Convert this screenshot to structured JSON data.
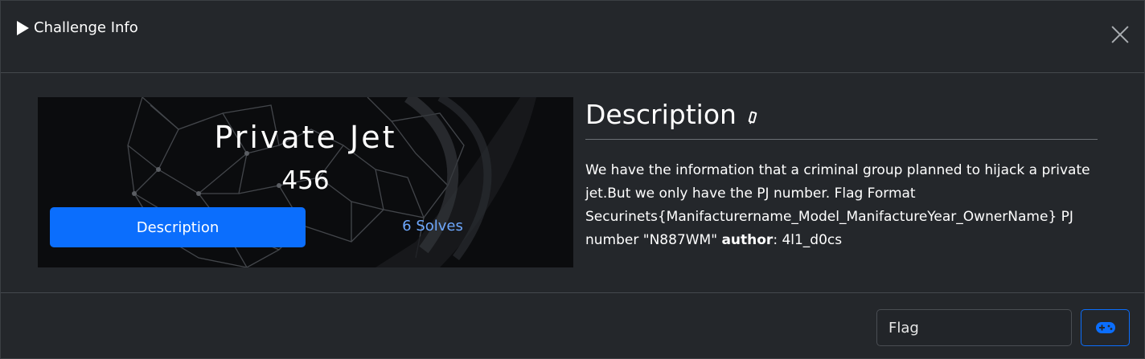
{
  "header": {
    "title": "Challenge Info"
  },
  "challenge": {
    "name": "Private Jet",
    "points": "456",
    "tabs": {
      "description": "Description",
      "solves": "6 Solves"
    }
  },
  "description": {
    "heading": "Description",
    "text_before_author": "We have the information that a criminal group planned to hijack a private jet.But we only have the PJ number. Flag Format Securinets{Manifacturername_Model_ManifactureYear_OwnerName} PJ number \"N887WM\" ",
    "author_label": "author",
    "author_value": ": 4l1_d0cs"
  },
  "footer": {
    "flag_placeholder": "Flag"
  },
  "colors": {
    "primary": "#0b6efd",
    "solves_link": "#6ea8fe",
    "background": "#24272b"
  },
  "icons": {
    "title": "play-icon",
    "close": "close-icon",
    "heading": "edit-icon",
    "submit": "gamepad-icon"
  }
}
